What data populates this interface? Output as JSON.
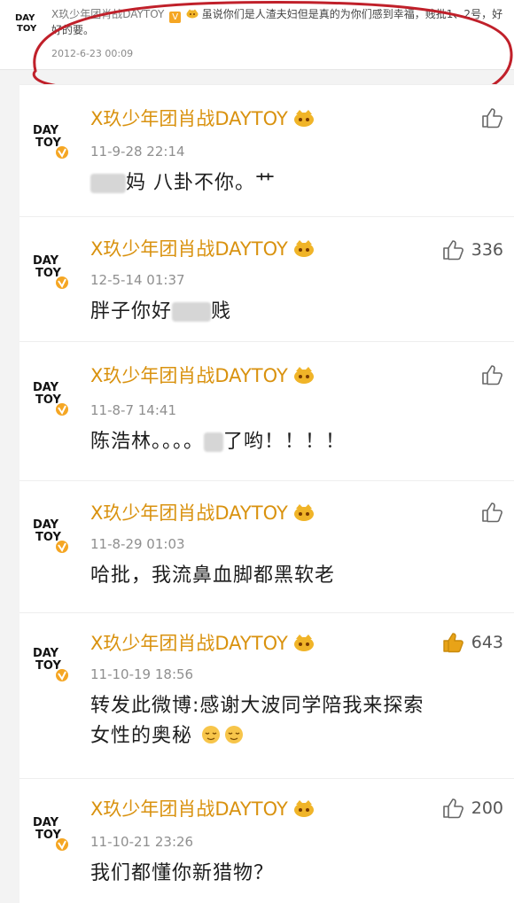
{
  "top_post": {
    "username": "X玖少年团肖战DAYTOY",
    "text": "虽说你们是人渣夫妇但是真的为你们感到幸福，贱批1、2号，好好的要。",
    "date": "2012-6-23 00:09",
    "avatar_text": "DAYTOY"
  },
  "comments": [
    {
      "username": "X玖少年团肖战DAYTOY",
      "time": "11-9-28 22:14",
      "text_parts": [
        "妈  八卦不你。艹"
      ],
      "likes": "",
      "like_active": false
    },
    {
      "username": "X玖少年团肖战DAYTOY",
      "time": "12-5-14 01:37",
      "text_parts": [
        "胖子你好",
        "贱"
      ],
      "likes": "336",
      "like_active": false
    },
    {
      "username": "X玖少年团肖战DAYTOY",
      "time": "11-8-7 14:41",
      "text_parts": [
        "陈浩林。。。。",
        "了哟！！！！"
      ],
      "likes": "",
      "like_active": false
    },
    {
      "username": "X玖少年团肖战DAYTOY",
      "time": "11-8-29 01:03",
      "text": "哈批，我流鼻血脚都黑软老",
      "likes": "",
      "like_active": false
    },
    {
      "username": "X玖少年团肖战DAYTOY",
      "time": "11-10-19 18:56",
      "text_line1": "转发此微博:感谢大波同学陪我来探索",
      "text_line2": "女性的奥秘",
      "likes": "643",
      "like_active": true
    },
    {
      "username": "X玖少年团肖战DAYTOY",
      "time": "11-10-21 23:26",
      "text": "我们都懂你新猎物？",
      "likes": "200",
      "like_active": false
    }
  ],
  "colors": {
    "username": "#d9920f",
    "like_active": "#e8a317",
    "annotation": "#c0202a"
  },
  "icons": {
    "like": "thumbs-up-icon",
    "verified": "verified-badge-icon",
    "crown": "crown-badge-icon"
  }
}
